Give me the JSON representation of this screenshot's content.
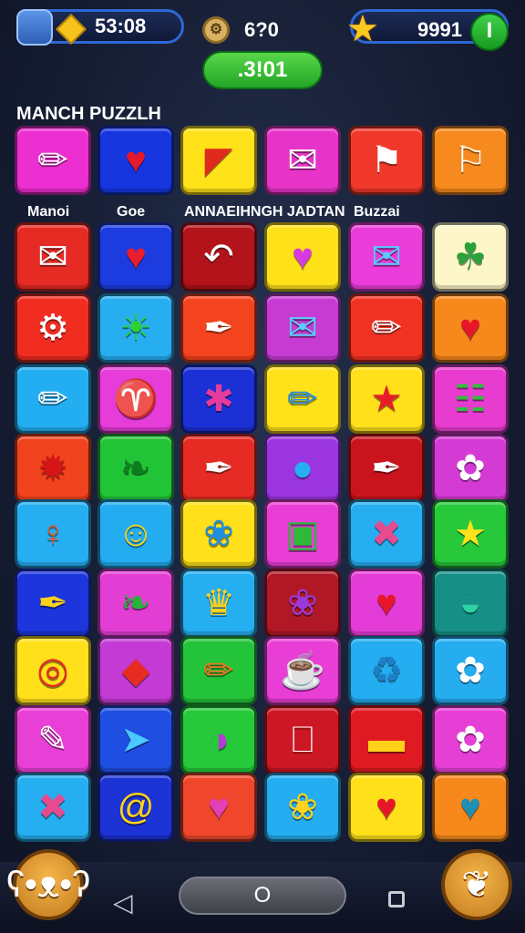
{
  "hud": {
    "map_icon": "map-icon",
    "gem_icon": "gem-icon",
    "coins": "53:08",
    "coin_icon_symbol": "⚙",
    "moves": "6?0",
    "star_icon": "star-icon",
    "score": "9991",
    "plus_label": "I"
  },
  "timer": ".3!01",
  "title": "MANCH PUZZLH",
  "categories": [
    "Manoi",
    "Goe",
    "ANNAEIHNGH JADTAN",
    "Buzzai"
  ],
  "tiles": [
    {
      "icon": "pencil-icon",
      "glyph": "✏",
      "color": "#ec2fd0"
    },
    {
      "icon": "heart-icon",
      "glyph": "♥",
      "color": "#1636e0",
      "fg": "#e6182c"
    },
    {
      "icon": "bow-icon",
      "glyph": "◤",
      "color": "#ffe21a",
      "fg": "#e02a1e"
    },
    {
      "icon": "envelope-icon",
      "glyph": "✉",
      "color": "#e634c8"
    },
    {
      "icon": "flag-icon",
      "glyph": "⚑",
      "color": "#f0392b"
    },
    {
      "icon": "flag-icon",
      "glyph": "⚐",
      "color": "#f78a1e"
    },
    {
      "icon": "envelope-icon",
      "glyph": "✉",
      "color": "#e52b24"
    },
    {
      "icon": "heart-icon",
      "glyph": "♥",
      "color": "#1d3ce0",
      "fg": "#ea1d2d"
    },
    {
      "icon": "arrow-icon",
      "glyph": "↶",
      "color": "#b3131b"
    },
    {
      "icon": "heart-icon",
      "glyph": "♥",
      "color": "#ffe11a",
      "fg": "#d53be0"
    },
    {
      "icon": "gift-icon",
      "glyph": "✉",
      "color": "#ea3cd8",
      "fg": "#5ec8ff"
    },
    {
      "icon": "leaf-icon",
      "glyph": "☘",
      "color": "#fdf6c8",
      "fg": "#2aa13a"
    },
    {
      "icon": "gear-icon",
      "glyph": "⚙",
      "color": "#f12d22"
    },
    {
      "icon": "sun-icon",
      "glyph": "☀",
      "color": "#27aef0",
      "fg": "#2ed12f"
    },
    {
      "icon": "feather-icon",
      "glyph": "✒",
      "color": "#f4431f"
    },
    {
      "icon": "gift-icon",
      "glyph": "✉",
      "color": "#c63bd2",
      "fg": "#5ec8ff"
    },
    {
      "icon": "pencil-icon",
      "glyph": "✏",
      "color": "#f03223"
    },
    {
      "icon": "heart-icon",
      "glyph": "♥",
      "color": "#f7881c",
      "fg": "#e8162b"
    },
    {
      "icon": "pencil-icon",
      "glyph": "✏",
      "color": "#23aef2"
    },
    {
      "icon": "ring-icon",
      "glyph": "♈",
      "color": "#e63cd8",
      "fg": "#f2c61c"
    },
    {
      "icon": "splat-icon",
      "glyph": "✱",
      "color": "#1b31d6",
      "fg": "#e63b9c"
    },
    {
      "icon": "pencil-icon",
      "glyph": "✏",
      "color": "#ffe21a",
      "fg": "#1f90e8"
    },
    {
      "icon": "star-icon",
      "glyph": "★",
      "color": "#ffe01a",
      "fg": "#e81d2a"
    },
    {
      "icon": "ticket-icon",
      "glyph": "☷",
      "color": "#e73ccf",
      "fg": "#2fbf3b"
    },
    {
      "icon": "splat-icon",
      "glyph": "✹",
      "color": "#f1431d",
      "fg": "#d61616"
    },
    {
      "icon": "leaf-icon",
      "glyph": "❧",
      "color": "#22c437",
      "fg": "#0d7e1e"
    },
    {
      "icon": "feather-icon",
      "glyph": "✒",
      "color": "#e62a24"
    },
    {
      "icon": "balloon-icon",
      "glyph": "●",
      "color": "#9a35e0",
      "fg": "#25aef0"
    },
    {
      "icon": "feather-icon",
      "glyph": "✒",
      "color": "#c9141e"
    },
    {
      "icon": "flower-icon",
      "glyph": "✿",
      "color": "#d43bd4"
    },
    {
      "icon": "spoon-icon",
      "glyph": "♀",
      "color": "#25aef0",
      "fg": "#e2572a"
    },
    {
      "icon": "sun-face-icon",
      "glyph": "☺",
      "color": "#23adf0",
      "fg": "#ffd21a"
    },
    {
      "icon": "splat-icon",
      "glyph": "❀",
      "color": "#ffe01a",
      "fg": "#1f8fe0"
    },
    {
      "icon": "toolbox-icon",
      "glyph": "▣",
      "color": "#e83ed6",
      "fg": "#2fb83a"
    },
    {
      "icon": "tools-icon",
      "glyph": "✖",
      "color": "#26aef1",
      "fg": "#e64a8f"
    },
    {
      "icon": "star-icon",
      "glyph": "★",
      "color": "#28c83b",
      "fg": "#ffe31c"
    },
    {
      "icon": "feather-icon",
      "glyph": "✒",
      "color": "#1d35dc",
      "fg": "#ffd21a"
    },
    {
      "icon": "leaf-icon",
      "glyph": "❧",
      "color": "#e23ed4",
      "fg": "#26b33a"
    },
    {
      "icon": "crown-icon",
      "glyph": "♛",
      "color": "#25aef0",
      "fg": "#ffd21a"
    },
    {
      "icon": "flower-icon",
      "glyph": "❀",
      "color": "#b01826",
      "fg": "#9b3ad8"
    },
    {
      "icon": "heart-icon",
      "glyph": "♥",
      "color": "#e43cd7",
      "fg": "#e8162b"
    },
    {
      "icon": "bowl-icon",
      "glyph": "◒",
      "color": "#168f86",
      "fg": "#2ed0a4"
    },
    {
      "icon": "target-icon",
      "glyph": "◎",
      "color": "#ffe01a",
      "fg": "#e52b22"
    },
    {
      "icon": "cube-icon",
      "glyph": "◆",
      "color": "#c33bd4",
      "fg": "#e52b22"
    },
    {
      "icon": "pencil-icon",
      "glyph": "✏",
      "color": "#23c43a",
      "fg": "#f2721e"
    },
    {
      "icon": "faucet-icon",
      "glyph": "☕",
      "color": "#e83ed6",
      "fg": "#ffeea0"
    },
    {
      "icon": "recycle-icon",
      "glyph": "♻",
      "color": "#24adf0",
      "fg": "#1e7fc9"
    },
    {
      "icon": "daisy-icon",
      "glyph": "✿",
      "color": "#25adf0",
      "fg": "#ffffff"
    },
    {
      "icon": "eraser-icon",
      "glyph": "✎",
      "color": "#e83fd6"
    },
    {
      "icon": "wing-icon",
      "glyph": "➤",
      "color": "#1f4fe2",
      "fg": "#49c9ff"
    },
    {
      "icon": "ball-icon",
      "glyph": "◑",
      "color": "#25c93a",
      "fg": "#b43bd4"
    },
    {
      "icon": "jar-icon",
      "glyph": "⎕",
      "color": "#cc1824"
    },
    {
      "icon": "box-icon",
      "glyph": "▬",
      "color": "#e01a22",
      "fg": "#ffd21a"
    },
    {
      "icon": "flower-icon",
      "glyph": "✿",
      "color": "#e63fd6"
    },
    {
      "icon": "tools-icon",
      "glyph": "✖",
      "color": "#25aef0",
      "fg": "#e64a8f"
    },
    {
      "icon": "swirl-icon",
      "glyph": "@",
      "color": "#1c33d6",
      "fg": "#ffd21a"
    },
    {
      "icon": "heart-icon",
      "glyph": "♥",
      "color": "#f0462b",
      "fg": "#e23fb8"
    },
    {
      "icon": "flower-icon",
      "glyph": "❀",
      "color": "#24adf0",
      "fg": "#ffd21a"
    },
    {
      "icon": "heart-icon",
      "glyph": "♥",
      "color": "#ffe01a",
      "fg": "#e8162b"
    },
    {
      "icon": "heart-icon",
      "glyph": "♥",
      "color": "#f7891c",
      "fg": "#1e8fb5"
    }
  ],
  "bottom": {
    "left_button_icon": "bear-icon",
    "right_button_icon": "dog-icon",
    "home_label": "O",
    "back_icon": "back-triangle-icon",
    "recent_icon": "recent-square-icon"
  }
}
